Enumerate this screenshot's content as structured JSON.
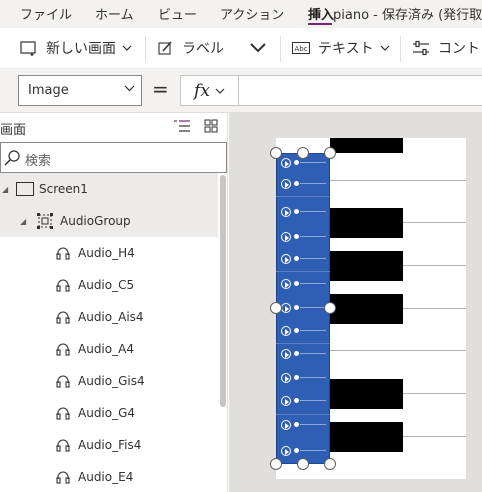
{
  "menu": {
    "items": [
      "ファイル",
      "ホーム",
      "ビュー",
      "アクション",
      "挿入"
    ],
    "active": "挿入",
    "doc_title": "piano - 保存済み (発行取"
  },
  "toolbar": {
    "new_screen": "新しい画面",
    "label": "ラベル",
    "text": "テキスト",
    "controls": "コント"
  },
  "formula": {
    "property": "Image",
    "equals": "=",
    "fx": "fx",
    "value": ""
  },
  "tree": {
    "title": "画面",
    "search_placeholder": "検索",
    "screen": "Screen1",
    "group": "AudioGroup",
    "items": [
      "Audio_H4",
      "Audio_C5",
      "Audio_Ais4",
      "Audio_A4",
      "Audio_Gis4",
      "Audio_G4",
      "Audio_Fis4",
      "Audio_E4"
    ]
  },
  "colors": {
    "accent": "#742774",
    "audio_blue": "#2f5fb4",
    "black_key": "#000000"
  },
  "icons": {
    "new_screen": "new-screen-icon",
    "label": "pencil-icon",
    "text": "text-input-icon",
    "controls": "controls-icon",
    "search": "search-icon",
    "screen": "screen-icon",
    "group": "group-icon",
    "audio": "headphones-icon"
  }
}
